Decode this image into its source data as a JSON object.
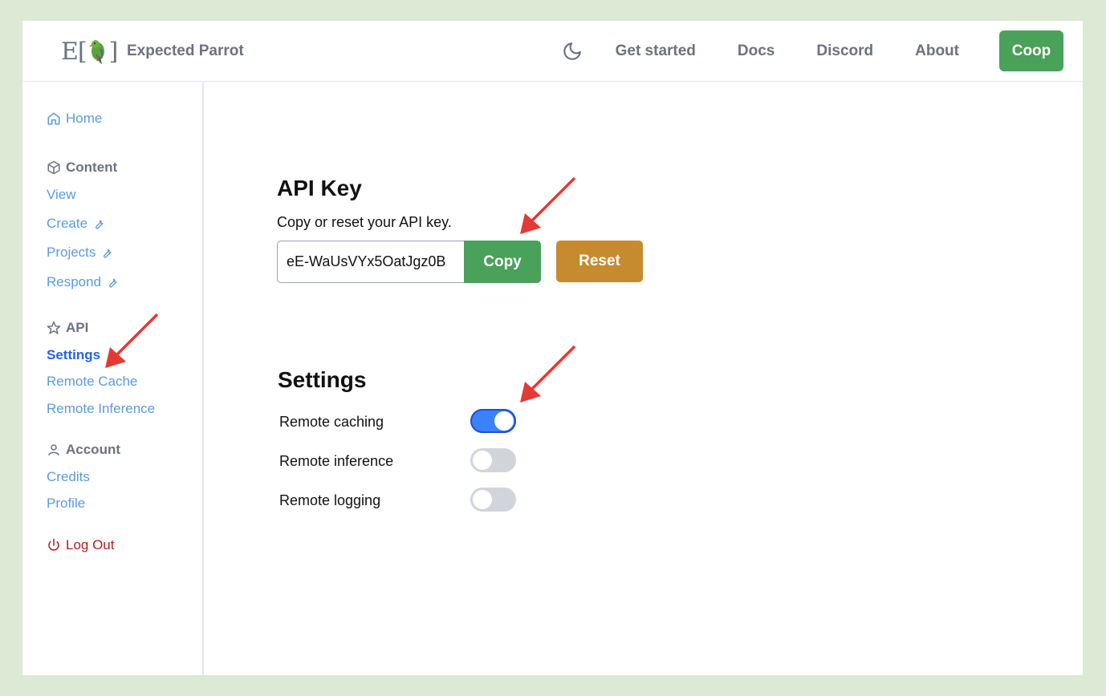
{
  "header": {
    "brand": "Expected Parrot",
    "logo_left": "E[",
    "logo_right": "]",
    "nav": [
      "Get started",
      "Docs",
      "Discord",
      "About"
    ],
    "coop_label": "Coop"
  },
  "sidebar": {
    "home": "Home",
    "content_section": "Content",
    "content_items": [
      "View",
      "Create",
      "Projects",
      "Respond"
    ],
    "api_section": "API",
    "api_items": [
      "Settings",
      "Remote Cache",
      "Remote Inference"
    ],
    "account_section": "Account",
    "account_items": [
      "Credits",
      "Profile"
    ],
    "logout": "Log Out"
  },
  "api_key": {
    "title": "API Key",
    "subtitle": "Copy or reset your API key.",
    "value": "eE-WaUsVYx5OatJgz0B",
    "copy_label": "Copy",
    "reset_label": "Reset"
  },
  "settings": {
    "title": "Settings",
    "rows": [
      {
        "label": "Remote caching",
        "on": true
      },
      {
        "label": "Remote inference",
        "on": false
      },
      {
        "label": "Remote logging",
        "on": false
      }
    ]
  },
  "colors": {
    "accent_green": "#4aa15a",
    "reset_gold": "#c68b2f",
    "toggle_on": "#3b82f6",
    "link_blue": "#5b9be0",
    "logout_red": "#b91c1c",
    "annotation_arrow": "#e53935"
  }
}
